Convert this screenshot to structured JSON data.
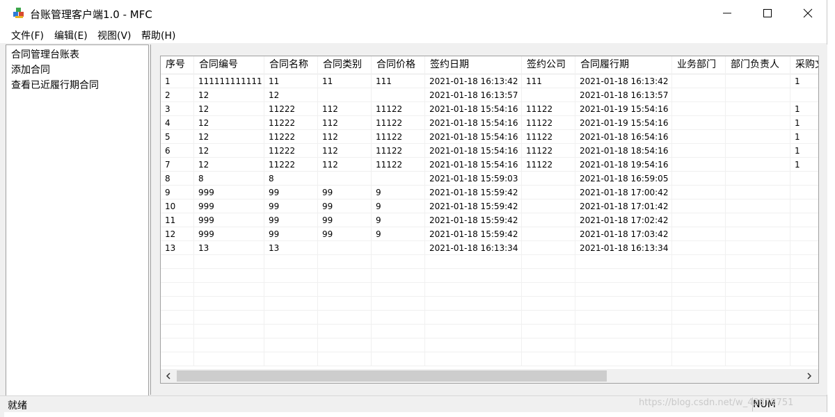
{
  "window": {
    "title": "台账管理客户端1.0 - MFC",
    "icon": "app-stack-icon",
    "controls": [
      "minimize-icon",
      "maximize-icon",
      "close-icon"
    ]
  },
  "menu": [
    "文件(F)",
    "编辑(E)",
    "视图(V)",
    "帮助(H)"
  ],
  "nav": [
    "合同管理台账表",
    "添加合同",
    "查看已近履行期合同"
  ],
  "table": {
    "columns": [
      "序号",
      "合同编号",
      "合同名称",
      "合同类别",
      "合同价格",
      "签约日期",
      "签约公司",
      "合同履行期",
      "业务部门",
      "部门负责人",
      "采购文"
    ],
    "rows": [
      [
        "1",
        "111111111111",
        "11",
        "11",
        "111",
        "2021-01-18 16:13:42",
        "111",
        "2021-01-18 16:13:42",
        "",
        "",
        "1"
      ],
      [
        "2",
        "12",
        "12",
        "",
        "",
        "2021-01-18 16:13:57",
        "",
        "2021-01-18 16:13:57",
        "",
        "",
        ""
      ],
      [
        "3",
        "12",
        "11222",
        "112",
        "11122",
        "2021-01-18 15:54:16",
        "11122",
        "2021-01-19 15:54:16",
        "",
        "",
        "1"
      ],
      [
        "4",
        "12",
        "11222",
        "112",
        "11122",
        "2021-01-18 15:54:16",
        "11122",
        "2021-01-19 15:54:16",
        "",
        "",
        "1"
      ],
      [
        "5",
        "12",
        "11222",
        "112",
        "11122",
        "2021-01-18 15:54:16",
        "11122",
        "2021-01-18 16:54:16",
        "",
        "",
        "1"
      ],
      [
        "6",
        "12",
        "11222",
        "112",
        "11122",
        "2021-01-18 15:54:16",
        "11122",
        "2021-01-18 18:54:16",
        "",
        "",
        "1"
      ],
      [
        "7",
        "12",
        "11222",
        "112",
        "11122",
        "2021-01-18 15:54:16",
        "11122",
        "2021-01-18 19:54:16",
        "",
        "",
        "1"
      ],
      [
        "8",
        "8",
        "8",
        "",
        "",
        "2021-01-18 15:59:03",
        "",
        "2021-01-18 16:59:05",
        "",
        "",
        ""
      ],
      [
        "9",
        "999",
        "99",
        "99",
        "9",
        "2021-01-18 15:59:42",
        "",
        "2021-01-18 17:00:42",
        "",
        "",
        ""
      ],
      [
        "10",
        "999",
        "99",
        "99",
        "9",
        "2021-01-18 15:59:42",
        "",
        "2021-01-18 17:01:42",
        "",
        "",
        ""
      ],
      [
        "11",
        "999",
        "99",
        "99",
        "9",
        "2021-01-18 15:59:42",
        "",
        "2021-01-18 17:02:42",
        "",
        "",
        ""
      ],
      [
        "12",
        "999",
        "99",
        "99",
        "9",
        "2021-01-18 15:59:42",
        "",
        "2021-01-18 17:03:42",
        "",
        "",
        ""
      ],
      [
        "13",
        "13",
        "13",
        "",
        "",
        "2021-01-18 16:13:34",
        "",
        "2021-01-18 16:13:34",
        "",
        "",
        ""
      ]
    ]
  },
  "status": {
    "text": "就绪",
    "num": "NUM"
  },
  "watermark": "https://blog.csdn.net/w_43878751"
}
